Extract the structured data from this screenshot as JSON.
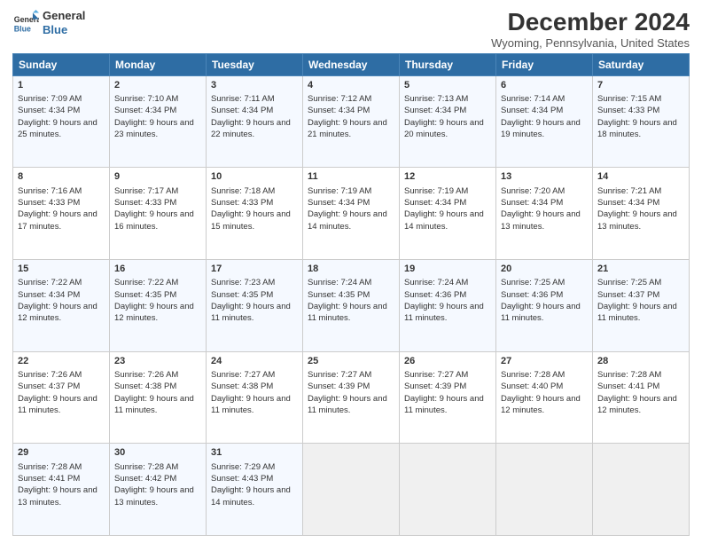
{
  "logo": {
    "line1": "General",
    "line2": "Blue"
  },
  "title": "December 2024",
  "subtitle": "Wyoming, Pennsylvania, United States",
  "header_color": "#2e6da4",
  "days_of_week": [
    "Sunday",
    "Monday",
    "Tuesday",
    "Wednesday",
    "Thursday",
    "Friday",
    "Saturday"
  ],
  "weeks": [
    [
      {
        "day": "1",
        "sunrise": "Sunrise: 7:09 AM",
        "sunset": "Sunset: 4:34 PM",
        "daylight": "Daylight: 9 hours and 25 minutes."
      },
      {
        "day": "2",
        "sunrise": "Sunrise: 7:10 AM",
        "sunset": "Sunset: 4:34 PM",
        "daylight": "Daylight: 9 hours and 23 minutes."
      },
      {
        "day": "3",
        "sunrise": "Sunrise: 7:11 AM",
        "sunset": "Sunset: 4:34 PM",
        "daylight": "Daylight: 9 hours and 22 minutes."
      },
      {
        "day": "4",
        "sunrise": "Sunrise: 7:12 AM",
        "sunset": "Sunset: 4:34 PM",
        "daylight": "Daylight: 9 hours and 21 minutes."
      },
      {
        "day": "5",
        "sunrise": "Sunrise: 7:13 AM",
        "sunset": "Sunset: 4:34 PM",
        "daylight": "Daylight: 9 hours and 20 minutes."
      },
      {
        "day": "6",
        "sunrise": "Sunrise: 7:14 AM",
        "sunset": "Sunset: 4:34 PM",
        "daylight": "Daylight: 9 hours and 19 minutes."
      },
      {
        "day": "7",
        "sunrise": "Sunrise: 7:15 AM",
        "sunset": "Sunset: 4:33 PM",
        "daylight": "Daylight: 9 hours and 18 minutes."
      }
    ],
    [
      {
        "day": "8",
        "sunrise": "Sunrise: 7:16 AM",
        "sunset": "Sunset: 4:33 PM",
        "daylight": "Daylight: 9 hours and 17 minutes."
      },
      {
        "day": "9",
        "sunrise": "Sunrise: 7:17 AM",
        "sunset": "Sunset: 4:33 PM",
        "daylight": "Daylight: 9 hours and 16 minutes."
      },
      {
        "day": "10",
        "sunrise": "Sunrise: 7:18 AM",
        "sunset": "Sunset: 4:33 PM",
        "daylight": "Daylight: 9 hours and 15 minutes."
      },
      {
        "day": "11",
        "sunrise": "Sunrise: 7:19 AM",
        "sunset": "Sunset: 4:34 PM",
        "daylight": "Daylight: 9 hours and 14 minutes."
      },
      {
        "day": "12",
        "sunrise": "Sunrise: 7:19 AM",
        "sunset": "Sunset: 4:34 PM",
        "daylight": "Daylight: 9 hours and 14 minutes."
      },
      {
        "day": "13",
        "sunrise": "Sunrise: 7:20 AM",
        "sunset": "Sunset: 4:34 PM",
        "daylight": "Daylight: 9 hours and 13 minutes."
      },
      {
        "day": "14",
        "sunrise": "Sunrise: 7:21 AM",
        "sunset": "Sunset: 4:34 PM",
        "daylight": "Daylight: 9 hours and 13 minutes."
      }
    ],
    [
      {
        "day": "15",
        "sunrise": "Sunrise: 7:22 AM",
        "sunset": "Sunset: 4:34 PM",
        "daylight": "Daylight: 9 hours and 12 minutes."
      },
      {
        "day": "16",
        "sunrise": "Sunrise: 7:22 AM",
        "sunset": "Sunset: 4:35 PM",
        "daylight": "Daylight: 9 hours and 12 minutes."
      },
      {
        "day": "17",
        "sunrise": "Sunrise: 7:23 AM",
        "sunset": "Sunset: 4:35 PM",
        "daylight": "Daylight: 9 hours and 11 minutes."
      },
      {
        "day": "18",
        "sunrise": "Sunrise: 7:24 AM",
        "sunset": "Sunset: 4:35 PM",
        "daylight": "Daylight: 9 hours and 11 minutes."
      },
      {
        "day": "19",
        "sunrise": "Sunrise: 7:24 AM",
        "sunset": "Sunset: 4:36 PM",
        "daylight": "Daylight: 9 hours and 11 minutes."
      },
      {
        "day": "20",
        "sunrise": "Sunrise: 7:25 AM",
        "sunset": "Sunset: 4:36 PM",
        "daylight": "Daylight: 9 hours and 11 minutes."
      },
      {
        "day": "21",
        "sunrise": "Sunrise: 7:25 AM",
        "sunset": "Sunset: 4:37 PM",
        "daylight": "Daylight: 9 hours and 11 minutes."
      }
    ],
    [
      {
        "day": "22",
        "sunrise": "Sunrise: 7:26 AM",
        "sunset": "Sunset: 4:37 PM",
        "daylight": "Daylight: 9 hours and 11 minutes."
      },
      {
        "day": "23",
        "sunrise": "Sunrise: 7:26 AM",
        "sunset": "Sunset: 4:38 PM",
        "daylight": "Daylight: 9 hours and 11 minutes."
      },
      {
        "day": "24",
        "sunrise": "Sunrise: 7:27 AM",
        "sunset": "Sunset: 4:38 PM",
        "daylight": "Daylight: 9 hours and 11 minutes."
      },
      {
        "day": "25",
        "sunrise": "Sunrise: 7:27 AM",
        "sunset": "Sunset: 4:39 PM",
        "daylight": "Daylight: 9 hours and 11 minutes."
      },
      {
        "day": "26",
        "sunrise": "Sunrise: 7:27 AM",
        "sunset": "Sunset: 4:39 PM",
        "daylight": "Daylight: 9 hours and 11 minutes."
      },
      {
        "day": "27",
        "sunrise": "Sunrise: 7:28 AM",
        "sunset": "Sunset: 4:40 PM",
        "daylight": "Daylight: 9 hours and 12 minutes."
      },
      {
        "day": "28",
        "sunrise": "Sunrise: 7:28 AM",
        "sunset": "Sunset: 4:41 PM",
        "daylight": "Daylight: 9 hours and 12 minutes."
      }
    ],
    [
      {
        "day": "29",
        "sunrise": "Sunrise: 7:28 AM",
        "sunset": "Sunset: 4:41 PM",
        "daylight": "Daylight: 9 hours and 13 minutes."
      },
      {
        "day": "30",
        "sunrise": "Sunrise: 7:28 AM",
        "sunset": "Sunset: 4:42 PM",
        "daylight": "Daylight: 9 hours and 13 minutes."
      },
      {
        "day": "31",
        "sunrise": "Sunrise: 7:29 AM",
        "sunset": "Sunset: 4:43 PM",
        "daylight": "Daylight: 9 hours and 14 minutes."
      },
      null,
      null,
      null,
      null
    ]
  ]
}
